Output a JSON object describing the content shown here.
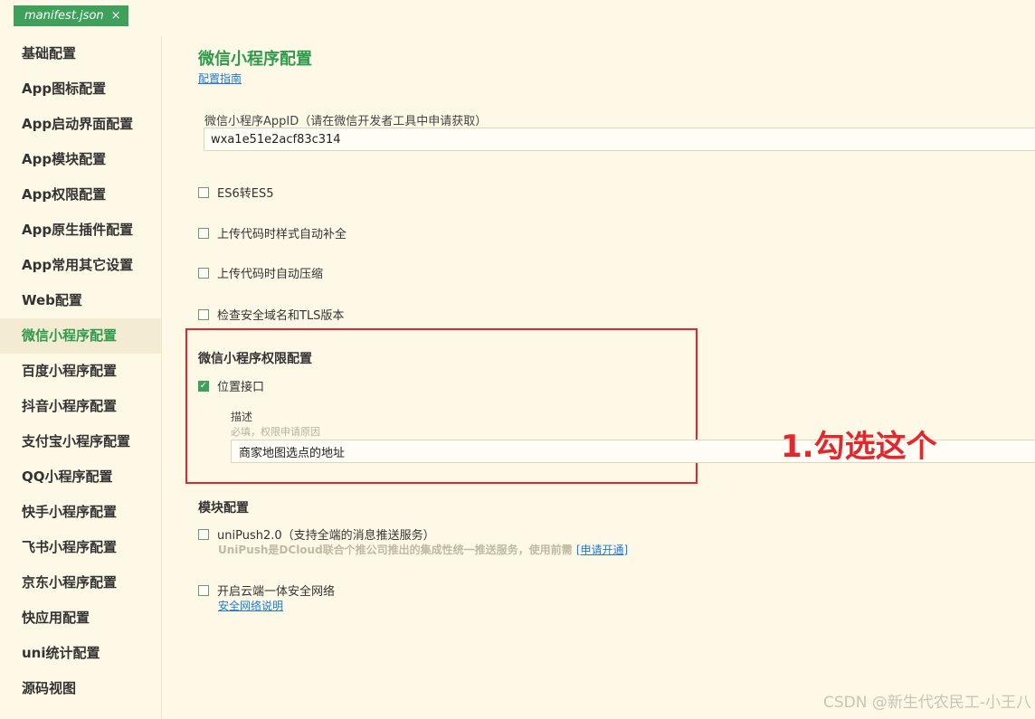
{
  "tab": {
    "label": "manifest.json",
    "close": "×"
  },
  "sidebar": {
    "items": [
      {
        "label": "基础配置"
      },
      {
        "label": "App图标配置"
      },
      {
        "label": "App启动界面配置"
      },
      {
        "label": "App模块配置"
      },
      {
        "label": "App权限配置"
      },
      {
        "label": "App原生插件配置"
      },
      {
        "label": "App常用其它设置"
      },
      {
        "label": "Web配置"
      },
      {
        "label": "微信小程序配置"
      },
      {
        "label": "百度小程序配置"
      },
      {
        "label": "抖音小程序配置"
      },
      {
        "label": "支付宝小程序配置"
      },
      {
        "label": "QQ小程序配置"
      },
      {
        "label": "快手小程序配置"
      },
      {
        "label": "飞书小程序配置"
      },
      {
        "label": "京东小程序配置"
      },
      {
        "label": "快应用配置"
      },
      {
        "label": "uni统计配置"
      },
      {
        "label": "源码视图"
      }
    ],
    "active_index": 8
  },
  "main": {
    "title": "微信小程序配置",
    "guide_link": "配置指南",
    "appid_label": "微信小程序AppID（请在微信开发者工具中申请获取）",
    "appid_value": "wxa1e51e2acf83c314",
    "options": [
      {
        "label": "ES6转ES5",
        "checked": false
      },
      {
        "label": "上传代码时样式自动补全",
        "checked": false
      },
      {
        "label": "上传代码时自动压缩",
        "checked": false
      },
      {
        "label": "检查安全域名和TLS版本",
        "checked": false
      }
    ],
    "permission": {
      "title": "微信小程序权限配置",
      "location_label": "位置接口",
      "location_checked": true,
      "desc_label": "描述",
      "desc_hint": "必填，权限申请原因",
      "desc_value": "商家地图选点的地址"
    },
    "modules": {
      "title": "模块配置",
      "unipush_label": "uniPush2.0（支持全端的消息推送服务）",
      "unipush_desc": "UniPush是DCloud联合个推公司推出的集成性统一推送服务，使用前需",
      "unipush_link": "[申请开通]",
      "secure_label": "开启云端一体安全网络",
      "secure_link": "安全网络说明"
    }
  },
  "annotation": {
    "text": "1.勾选这个",
    "color": "#e0282e"
  },
  "watermark": "CSDN @新生代农民工-小王八",
  "colors": {
    "accent": "#3ea05a",
    "background": "#fef9e7",
    "link": "#1e7bd6"
  }
}
